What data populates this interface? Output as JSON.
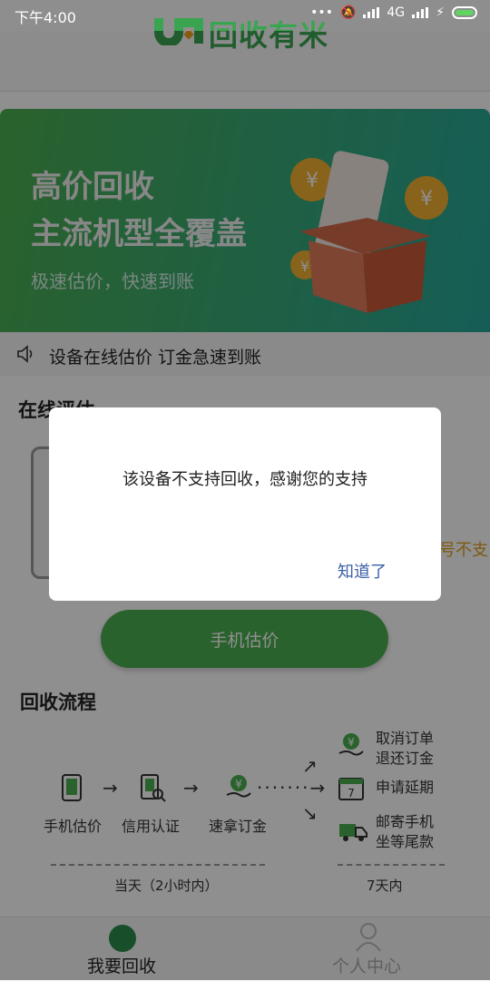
{
  "status_bar": {
    "time": "下午4:00",
    "network": "4G"
  },
  "header": {
    "logo_text": "回收有米"
  },
  "banner": {
    "title_line1": "高价回收",
    "title_line2": "主流机型全覆盖",
    "subtitle": "极速估价，快速到账"
  },
  "notice": {
    "text": "设备在线估价 订金急速到账"
  },
  "evaluation": {
    "title": "在线评估",
    "estimate_button": "手机估价",
    "hint_partial": "号不支"
  },
  "process": {
    "title": "回收流程",
    "steps": [
      "手机估价",
      "信用认证",
      "速拿订金"
    ],
    "branches": [
      "取消订单\n退还订金",
      "申请延期",
      "邮寄手机\n坐等尾款"
    ],
    "timeline": [
      "当天（2小时内）",
      "7天内"
    ]
  },
  "bottom_nav": {
    "recycle": "我要回收",
    "profile": "个人中心"
  },
  "dialog": {
    "message": "该设备不支持回收，感谢您的支持",
    "ok_button": "知道了"
  },
  "colors": {
    "brand_green": "#4caf50",
    "dialog_button": "#3a5fa8"
  }
}
